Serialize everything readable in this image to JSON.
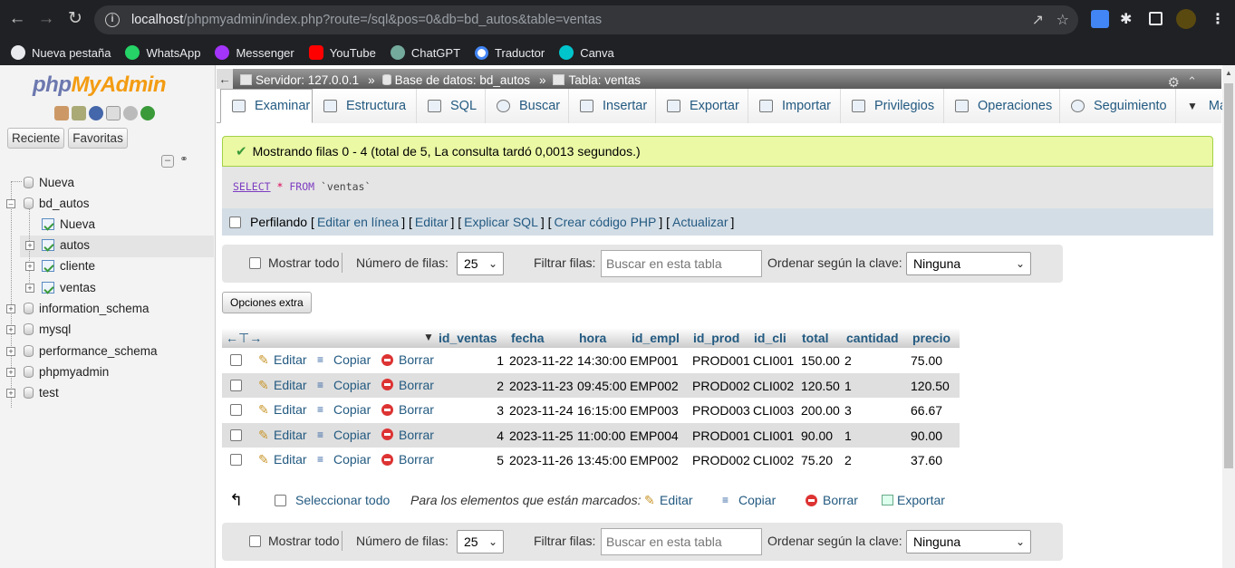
{
  "browser": {
    "url_host": "localhost",
    "url_path": "/phpmyadmin/index.php?route=/sql&pos=0&db=bd_autos&table=ventas",
    "bookmarks": [
      {
        "label": "Nueva pestaña",
        "icon": "globe-icon",
        "color": "#e8eaed"
      },
      {
        "label": "WhatsApp",
        "icon": "whatsapp-icon",
        "color": "#25d366"
      },
      {
        "label": "Messenger",
        "icon": "messenger-icon",
        "color": "#a334fa"
      },
      {
        "label": "YouTube",
        "icon": "youtube-icon",
        "color": "#ff0000"
      },
      {
        "label": "ChatGPT",
        "icon": "chatgpt-icon",
        "color": "#74aa9c"
      },
      {
        "label": "Traductor",
        "icon": "google-icon",
        "color": "#4285f4"
      },
      {
        "label": "Canva",
        "icon": "canva-icon",
        "color": "#00c4cc"
      }
    ]
  },
  "sidebar": {
    "logo_php": "php",
    "logo_myadmin": "MyAdmin",
    "tab_recent": "Reciente",
    "tab_favorites": "Favoritas",
    "tree": {
      "new": "Nueva",
      "db_bd_autos": "bd_autos",
      "bd_autos_new": "Nueva",
      "table_autos": "autos",
      "table_cliente": "cliente",
      "table_ventas": "ventas",
      "db_information_schema": "information_schema",
      "db_mysql": "mysql",
      "db_performance_schema": "performance_schema",
      "db_phpmyadmin": "phpmyadmin",
      "db_test": "test"
    }
  },
  "breadcrumb": {
    "server": "Servidor: 127.0.0.1",
    "database": "Base de datos: bd_autos",
    "table": "Tabla: ventas"
  },
  "tabs": [
    "Examinar",
    "Estructura",
    "SQL",
    "Buscar",
    "Insertar",
    "Exportar",
    "Importar",
    "Privilegios",
    "Operaciones",
    "Seguimiento",
    "Ma"
  ],
  "message": {
    "success": "Mostrando filas 0 - 4 (total de 5, La consulta tardó 0,0013 segundos.)"
  },
  "sql": {
    "select": "SELECT",
    "star": "*",
    "from": "FROM",
    "table": "`ventas`"
  },
  "profiling": {
    "label": "Perfilando",
    "lb1": "[",
    "edit_inline": "Editar en línea",
    "sep1": "] [",
    "edit": "Editar",
    "sep2": "] [",
    "explain": "Explicar SQL",
    "sep3": "] [",
    "php": "Crear código PHP",
    "sep4": "] [",
    "refresh": "Actualizar",
    "rb": "]"
  },
  "navbar": {
    "show_all": "Mostrar todo",
    "rows_label": "Número de filas:",
    "rows_value": "25",
    "filter_label": "Filtrar filas:",
    "filter_placeholder": "Buscar en esta tabla",
    "sort_label": "Ordenar según la clave:",
    "sort_value": "Ninguna"
  },
  "extra_options": "Opciones extra",
  "grid": {
    "columns": [
      "id_ventas",
      "fecha",
      "hora",
      "id_empl",
      "id_prod",
      "id_cli",
      "total",
      "cantidad",
      "precio"
    ],
    "action_edit": "Editar",
    "action_copy": "Copiar",
    "action_delete": "Borrar",
    "rows": [
      [
        "1",
        "2023-11-22",
        "14:30:00",
        "EMP001",
        "PROD001",
        "CLI001",
        "150.00",
        "2",
        "75.00"
      ],
      [
        "2",
        "2023-11-23",
        "09:45:00",
        "EMP002",
        "PROD002",
        "CLI002",
        "120.50",
        "1",
        "120.50"
      ],
      [
        "3",
        "2023-11-24",
        "16:15:00",
        "EMP003",
        "PROD003",
        "CLI003",
        "200.00",
        "3",
        "66.67"
      ],
      [
        "4",
        "2023-11-25",
        "11:00:00",
        "EMP004",
        "PROD001",
        "CLI001",
        "90.00",
        "1",
        "90.00"
      ],
      [
        "5",
        "2023-11-26",
        "13:45:00",
        "EMP002",
        "PROD002",
        "CLI002",
        "75.20",
        "2",
        "37.60"
      ]
    ]
  },
  "bulk": {
    "select_all": "Seleccionar todo",
    "for_marked": "Para los elementos que están marcados:",
    "edit": "Editar",
    "copy": "Copiar",
    "delete": "Borrar",
    "export": "Exportar"
  }
}
